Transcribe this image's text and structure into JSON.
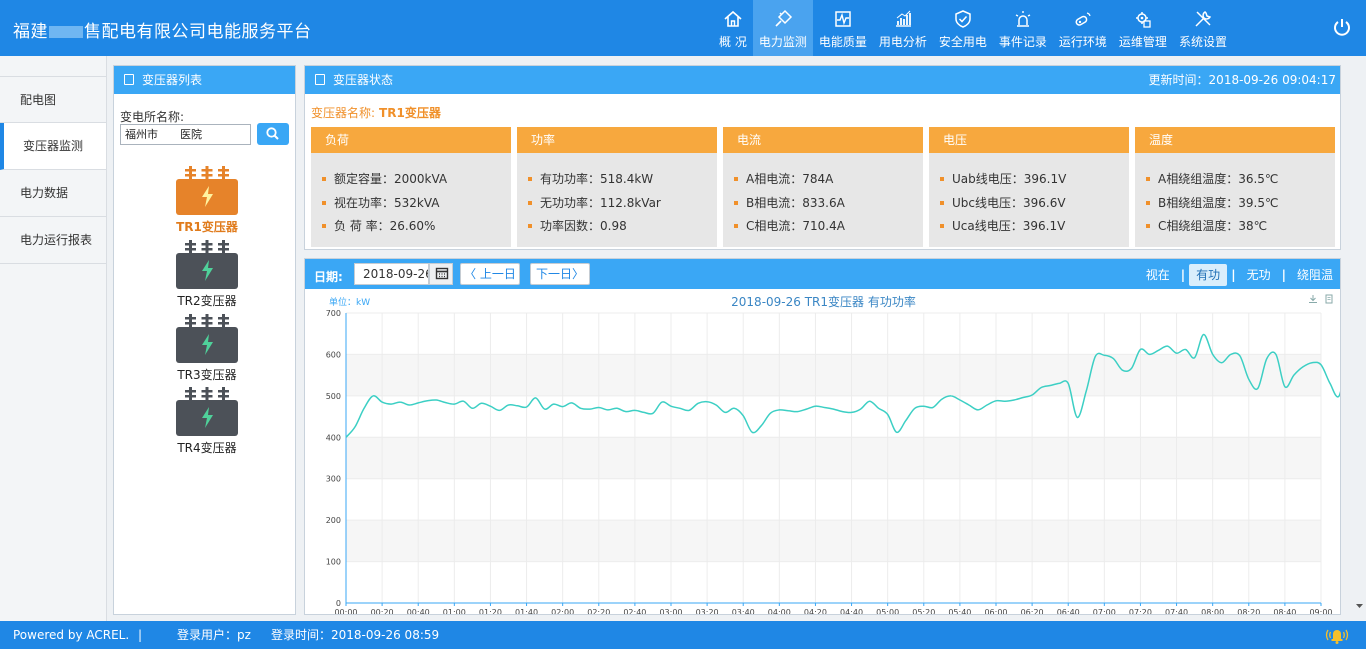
{
  "header": {
    "title_prefix": "福建",
    "title_suffix": "售配电有限公司电能服务平台",
    "nav": [
      {
        "label": "概 况",
        "icon": "home-icon"
      },
      {
        "label": "电力监测",
        "icon": "plug-icon",
        "active": true
      },
      {
        "label": "电能质量",
        "icon": "pulse-icon"
      },
      {
        "label": "用电分析",
        "icon": "bar-chart-icon"
      },
      {
        "label": "安全用电",
        "icon": "shield-check-icon"
      },
      {
        "label": "事件记录",
        "icon": "alarm-light-icon"
      },
      {
        "label": "运行环境",
        "icon": "sensor-icon"
      },
      {
        "label": "运维管理",
        "icon": "gear-box-icon"
      },
      {
        "label": "系统设置",
        "icon": "tools-icon"
      }
    ]
  },
  "left_menu": [
    {
      "label": "配电图"
    },
    {
      "label": "变压器监测",
      "active": true
    },
    {
      "label": "电力数据"
    },
    {
      "label": "电力运行报表"
    }
  ],
  "transformer_list": {
    "title": "变压器列表",
    "substation_label": "变电所名称:",
    "substation_value": "福州市　　医院",
    "items": [
      {
        "label": "TR1变压器",
        "selected": true
      },
      {
        "label": "TR2变压器"
      },
      {
        "label": "TR3变压器"
      },
      {
        "label": "TR4变压器"
      }
    ]
  },
  "status": {
    "title": "变压器状态",
    "update_time": "更新时间：2018-09-26 09:04:17",
    "name_label": "变压器名称:",
    "name_value": "TR1变压器",
    "cards": [
      {
        "title": "负荷",
        "items": [
          "额定容量：2000kVA",
          "视在功率：532kVA",
          "负 荷 率：26.60%"
        ]
      },
      {
        "title": "功率",
        "items": [
          "有功功率：518.4kW",
          "无功功率：112.8kVar",
          "功率因数：0.98"
        ]
      },
      {
        "title": "电流",
        "items": [
          "A相电流：784A",
          "B相电流：833.6A",
          "C相电流：710.4A"
        ]
      },
      {
        "title": "电压",
        "items": [
          "Uab线电压：396.1V",
          "Ubc线电压：396.6V",
          "Uca线电压：396.1V"
        ]
      },
      {
        "title": "温度",
        "items": [
          "A相绕组温度：36.5℃",
          "B相绕组温度：39.5℃",
          "C相绕组温度：38℃"
        ]
      }
    ]
  },
  "chart_controls": {
    "date_label": "日期:",
    "date_value": "2018-09-26",
    "prev_label": "〈 上一日",
    "next_label": "下一日〉",
    "tabs": [
      {
        "label": "视在"
      },
      {
        "label": "有功",
        "active": true
      },
      {
        "label": "无功"
      },
      {
        "label": "绕阻温"
      }
    ]
  },
  "chart_data": {
    "type": "line",
    "title": "2018-09-26  TR1变压器  有功功率",
    "unit_label": "单位：kW",
    "ylim": [
      0,
      700
    ],
    "yticks": [
      0,
      100,
      200,
      300,
      400,
      500,
      600,
      700
    ],
    "xticks": [
      "00:00",
      "00:20",
      "00:40",
      "01:00",
      "01:20",
      "01:40",
      "02:00",
      "02:20",
      "02:40",
      "03:00",
      "03:20",
      "03:40",
      "04:00",
      "04:20",
      "04:40",
      "05:00",
      "05:20",
      "05:40",
      "06:00",
      "06:20",
      "06:40",
      "07:00",
      "07:20",
      "07:40",
      "08:00",
      "08:20",
      "08:40",
      "09:00"
    ],
    "x_interval_minutes": 5,
    "series_color": "#3ccfc4",
    "grid": true,
    "values": [
      400,
      425,
      470,
      500,
      485,
      480,
      485,
      478,
      483,
      488,
      490,
      484,
      480,
      487,
      470,
      482,
      475,
      465,
      478,
      476,
      473,
      495,
      468,
      480,
      474,
      483,
      470,
      468,
      472,
      466,
      470,
      462,
      465,
      460,
      458,
      485,
      475,
      470,
      465,
      482,
      486,
      478,
      460,
      470,
      452,
      412,
      428,
      458,
      466,
      464,
      462,
      468,
      475,
      472,
      468,
      462,
      460,
      468,
      487,
      470,
      455,
      412,
      440,
      470,
      475,
      472,
      492,
      500,
      490,
      478,
      466,
      478,
      488,
      487,
      490,
      496,
      502,
      520,
      525,
      530,
      530,
      448,
      512,
      595,
      598,
      590,
      562,
      566,
      612,
      600,
      610,
      620,
      603,
      612,
      592,
      648,
      600,
      580,
      600,
      597,
      540,
      518,
      590,
      600,
      522,
      550,
      570,
      580,
      575,
      530,
      500,
      595,
      600,
      610,
      606,
      618,
      630,
      646,
      646,
      650,
      660,
      560,
      570,
      656,
      622,
      640,
      527
    ]
  },
  "footer": {
    "powered": "Powered by ACREL.",
    "sep": "|",
    "user": "登录用户：pz",
    "login_time": "登录时间：2018-09-26 08:59"
  }
}
